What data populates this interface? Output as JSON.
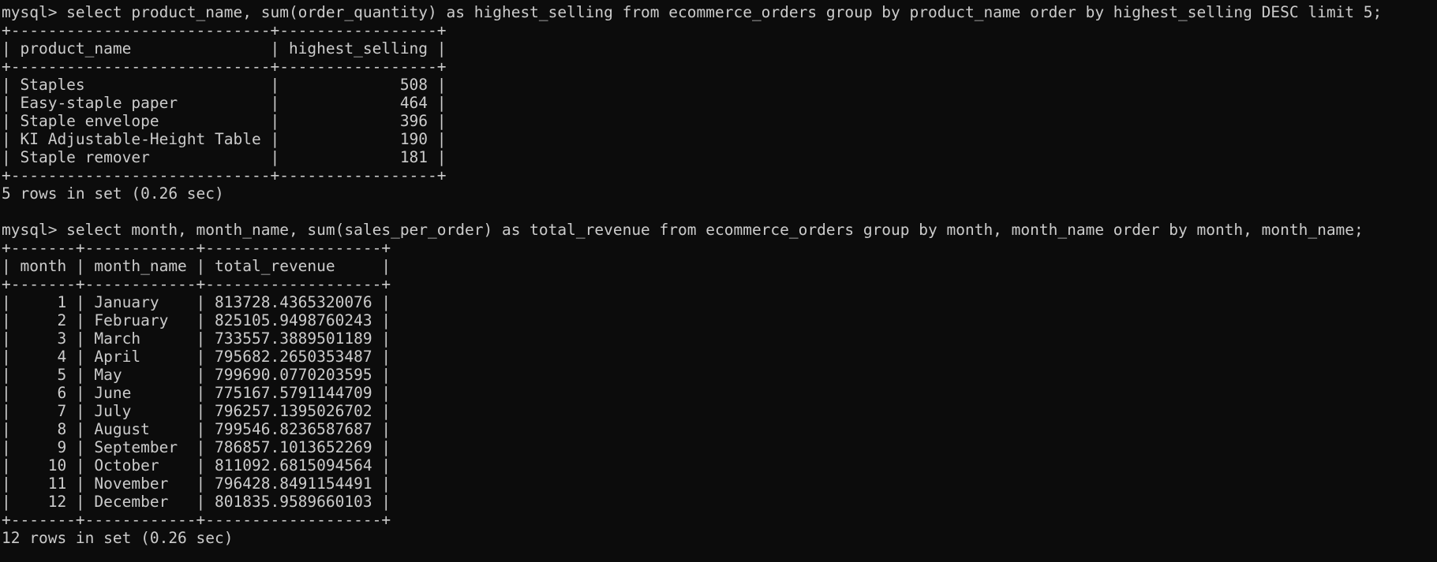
{
  "terminal": {
    "lines": [
      "mysql> select product_name, sum(order_quantity) as highest_selling from ecommerce_orders group by product_name order by highest_selling DESC limit 5;",
      "+----------------------------+-----------------+",
      "| product_name               | highest_selling |",
      "+----------------------------+-----------------+",
      "| Staples                    |             508 |",
      "| Easy-staple paper          |             464 |",
      "| Staple envelope            |             396 |",
      "| KI Adjustable-Height Table |             190 |",
      "| Staple remover             |             181 |",
      "+----------------------------+-----------------+",
      "5 rows in set (0.26 sec)",
      "",
      "mysql> select month, month_name, sum(sales_per_order) as total_revenue from ecommerce_orders group by month, month_name order by month, month_name;",
      "+-------+------------+-------------------+",
      "| month | month_name | total_revenue     |",
      "+-------+------------+-------------------+",
      "|     1 | January    | 813728.4365320076 |",
      "|     2 | February   | 825105.9498760243 |",
      "|     3 | March      | 733557.3889501189 |",
      "|     4 | April      | 795682.2650353487 |",
      "|     5 | May        | 799690.0770203595 |",
      "|     6 | June       | 775167.5791144709 |",
      "|     7 | July       | 796257.1395026702 |",
      "|     8 | August     | 799546.8236587687 |",
      "|     9 | September  | 786857.1013652269 |",
      "|    10 | October    | 811092.6815094564 |",
      "|    11 | November   | 796428.8491154491 |",
      "|    12 | December   | 801835.9589660103 |",
      "+-------+------------+-------------------+",
      "12 rows in set (0.26 sec)"
    ]
  }
}
